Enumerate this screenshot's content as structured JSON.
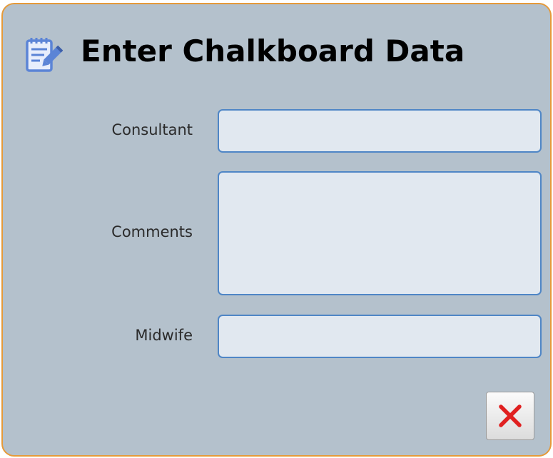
{
  "dialog": {
    "title": "Enter Chalkboard Data",
    "title_icon": "notepad-pencil-icon",
    "close_icon": "red-x-icon"
  },
  "form": {
    "consultant_label": "Consultant",
    "consultant_value": "",
    "comments_label": "Comments",
    "comments_value": "",
    "midwife_label": "Midwife",
    "midwife_value": ""
  },
  "colors": {
    "dialog_background": "#b4c1cc",
    "dialog_border": "#e59a3a",
    "field_background": "#e1e8f0",
    "field_border": "#4f86c6",
    "icon_blue": "#5b84d6",
    "close_red": "#e02020"
  }
}
